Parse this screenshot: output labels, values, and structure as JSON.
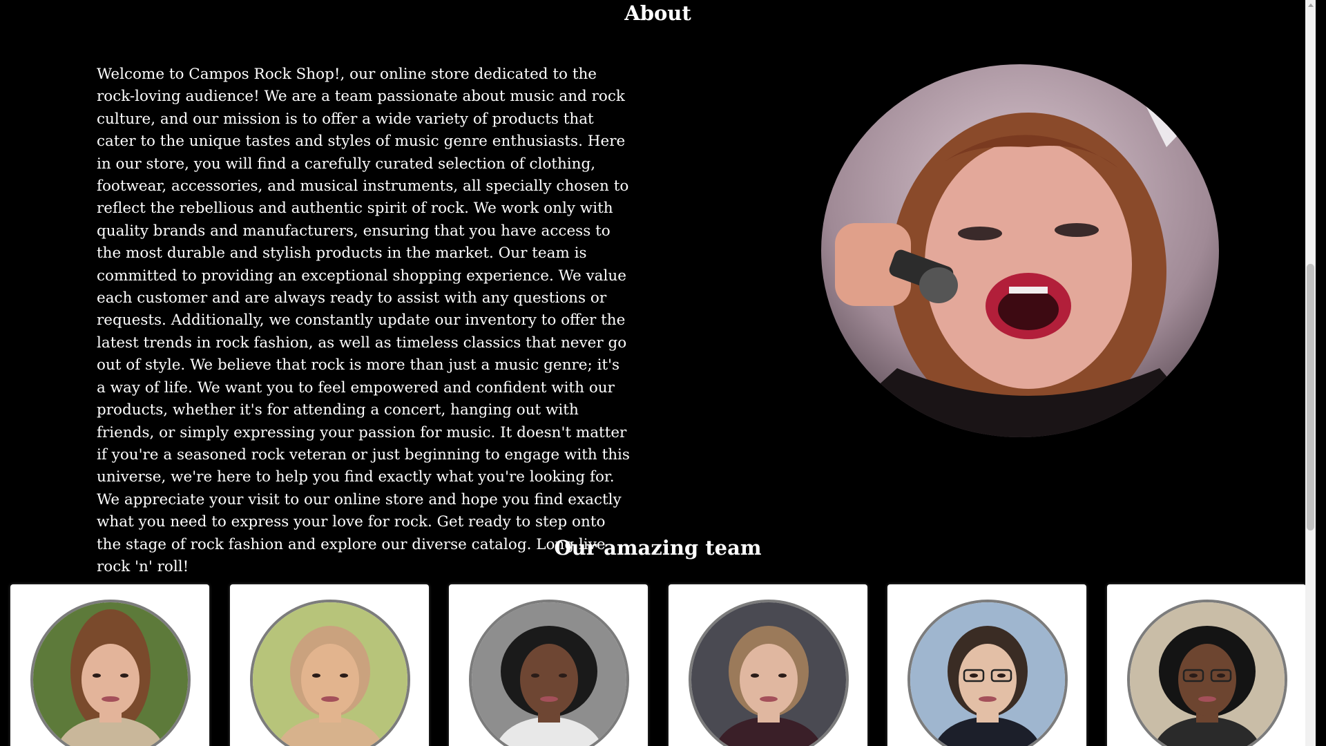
{
  "about": {
    "title": "About",
    "text": "Welcome to Campos Rock Shop!, our online store dedicated to the rock-loving audience! We are a team passionate about music and rock culture, and our mission is to offer a wide variety of products that cater to the unique tastes and styles of music genre enthusiasts. Here in our store, you will find a carefully curated selection of clothing, footwear, accessories, and musical instruments, all specially chosen to reflect the rebellious and authentic spirit of rock. We work only with quality brands and manufacturers, ensuring that you have access to the most durable and stylish products in the market. Our team is committed to providing an exceptional shopping experience. We value each customer and are always ready to assist with any questions or requests. Additionally, we constantly update our inventory to offer the latest trends in rock fashion, as well as timeless classics that never go out of style. We believe that rock is more than just a music genre; it's a way of life. We want you to feel empowered and confident with our products, whether it's for attending a concert, hanging out with friends, or simply expressing your passion for music. It doesn't matter if you're a seasoned rock veteran or just beginning to engage with this universe, we're here to help you find exactly what you're looking for. We appreciate your visit to our online store and hope you find exactly what you need to express your love for rock. Get ready to step onto the stage of rock fashion and explore our diverse catalog. Long live rock 'n' roll!"
  },
  "team": {
    "title": "Our amazing team",
    "members": [
      {
        "photo": "woman-long-hair-portrait",
        "bg": "#5d7a3a",
        "skin": "#e3b49a",
        "hair": "#7a4a2c",
        "shirt": "#c9b79a"
      },
      {
        "photo": "shaved-head-portrait",
        "bg": "#b7c47a",
        "skin": "#e2b48e",
        "hair": "#caa27e",
        "shirt": "#d7b28c"
      },
      {
        "photo": "woman-curly-hair-portrait",
        "bg": "#8e8e8e",
        "skin": "#6e4633",
        "hair": "#1a1a1a",
        "shirt": "#e8e8e8"
      },
      {
        "photo": "man-earring-portrait",
        "bg": "#4a4a52",
        "skin": "#e0b7a0",
        "hair": "#9b7a5a",
        "shirt": "#3a1f28"
      },
      {
        "photo": "man-glasses-suit-portrait",
        "bg": "#9fb6cf",
        "skin": "#e3bfa6",
        "hair": "#3a2c24",
        "shirt": "#1c1f2a"
      },
      {
        "photo": "man-afro-glasses-portrait",
        "bg": "#c9bda7",
        "skin": "#6d4530",
        "hair": "#141414",
        "shirt": "#2a2a2a"
      }
    ]
  },
  "hero": {
    "photo": "singer-with-microphone-photo"
  }
}
